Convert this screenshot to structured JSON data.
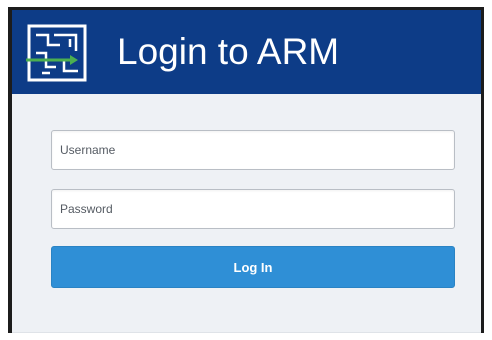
{
  "header": {
    "title": "Login to ARM",
    "logo_icon": "arm-maze-logo-icon",
    "background": "#0d3c87"
  },
  "form": {
    "username_placeholder": "Username",
    "password_placeholder": "Password",
    "login_label": "Log In",
    "button_color": "#2f8fd6"
  }
}
